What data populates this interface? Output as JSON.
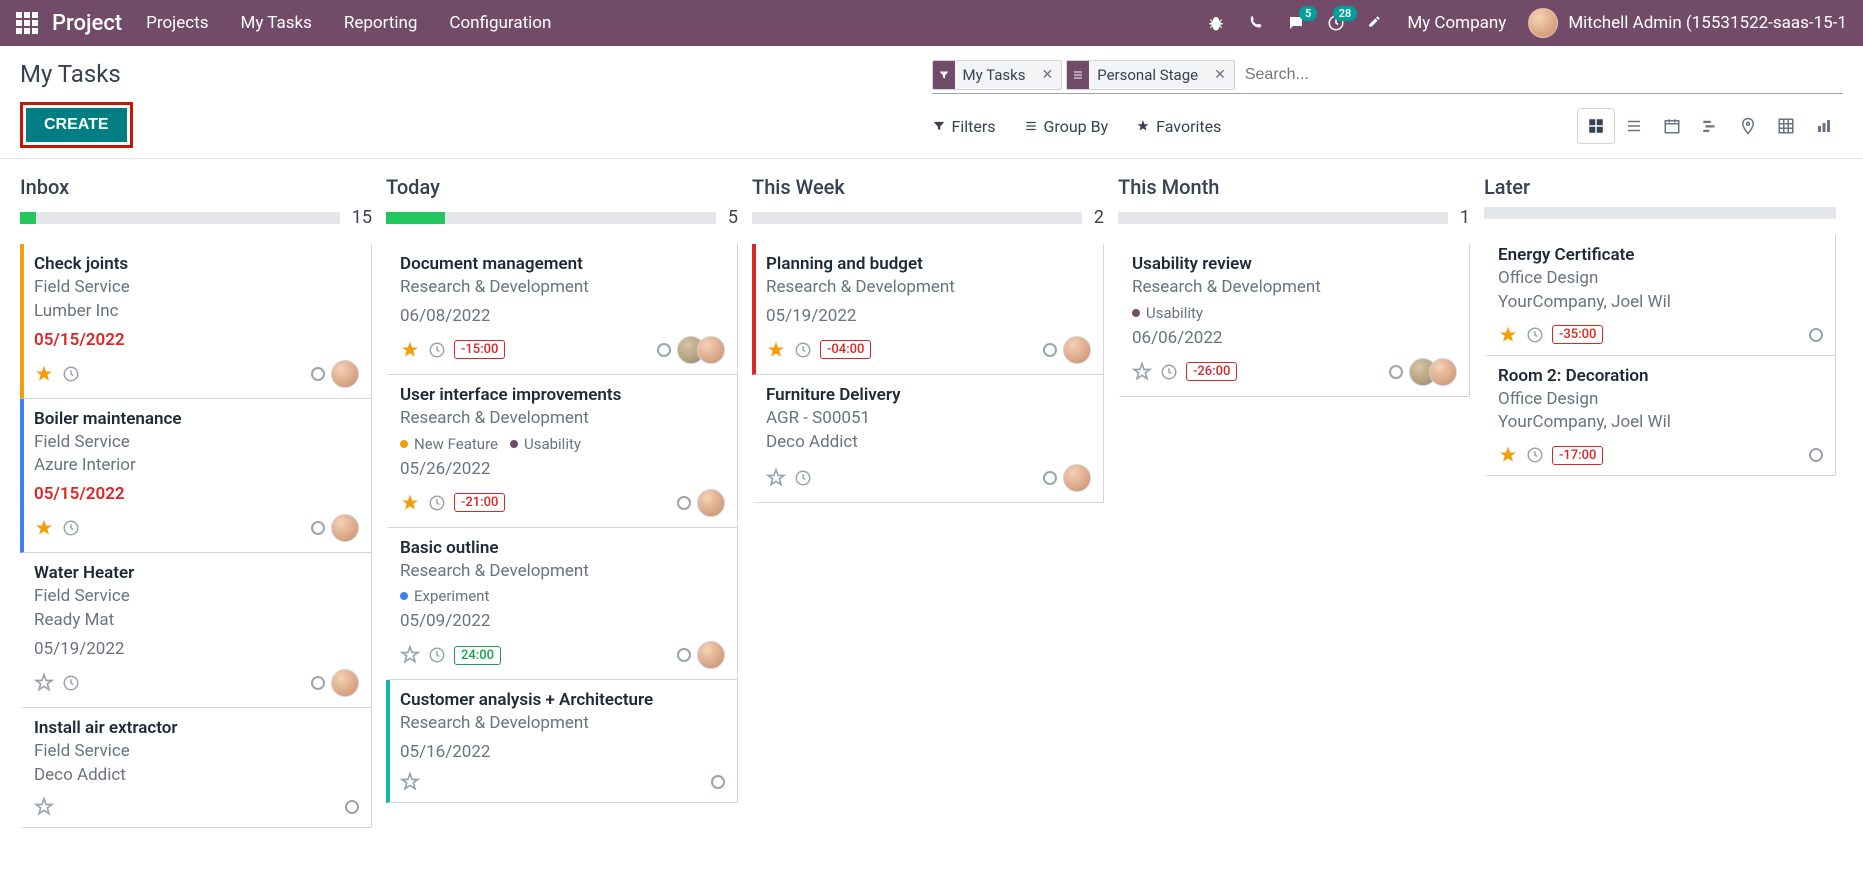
{
  "navbar": {
    "brand": "Project",
    "links": [
      "Projects",
      "My Tasks",
      "Reporting",
      "Configuration"
    ],
    "messages_badge": "5",
    "activities_badge": "28",
    "company": "My Company",
    "username": "Mitchell Admin (15531522-saas-15-1"
  },
  "control": {
    "title": "My Tasks",
    "create": "CREATE",
    "facets": [
      {
        "icon": "filter",
        "label": "My Tasks"
      },
      {
        "icon": "group",
        "label": "Personal Stage"
      }
    ],
    "search_placeholder": "Search...",
    "filters": "Filters",
    "groupby": "Group By",
    "favorites": "Favorites"
  },
  "columns": [
    {
      "title": "Inbox",
      "count": "15",
      "progress_pct": 5,
      "cards": [
        {
          "color": "orange",
          "title": "Check joints",
          "sub1": "Field Service",
          "sub2": "Lumber Inc",
          "date": "05/15/2022",
          "overdue": true,
          "star": true,
          "clock": true,
          "time": null,
          "assignees": 1
        },
        {
          "color": "blue",
          "title": "Boiler maintenance",
          "sub1": "Field Service",
          "sub2": "Azure Interior",
          "date": "05/15/2022",
          "overdue": true,
          "star": true,
          "clock": true,
          "time": null,
          "assignees": 1
        },
        {
          "color": "",
          "title": "Water Heater",
          "sub1": "Field Service",
          "sub2": "Ready Mat",
          "date": "05/19/2022",
          "overdue": false,
          "star": false,
          "clock": true,
          "time": null,
          "assignees": 1
        },
        {
          "color": "",
          "title": "Install air extractor",
          "sub1": "Field Service",
          "sub2": "Deco Addict",
          "date": "",
          "overdue": false,
          "star": false,
          "clock": false,
          "time": null,
          "assignees": 0
        }
      ]
    },
    {
      "title": "Today",
      "count": "5",
      "progress_pct": 18,
      "cards": [
        {
          "color": "",
          "title": "Document management",
          "sub1": "Research & Development",
          "sub2": "",
          "date": "06/08/2022",
          "overdue": false,
          "star": true,
          "clock": true,
          "time": "-15:00",
          "time_neg": true,
          "assignees": 2
        },
        {
          "color": "",
          "title": "User interface improvements",
          "sub1": "Research & Development",
          "sub2": "",
          "tags": [
            {
              "dot": "orange",
              "label": "New Feature"
            },
            {
              "dot": "purple",
              "label": "Usability"
            }
          ],
          "date": "05/26/2022",
          "overdue": false,
          "star": true,
          "clock": true,
          "time": "-21:00",
          "time_neg": true,
          "assignees": 1
        },
        {
          "color": "",
          "title": "Basic outline",
          "sub1": "Research & Development",
          "sub2": "",
          "tags": [
            {
              "dot": "blue",
              "label": "Experiment"
            }
          ],
          "date": "05/09/2022",
          "overdue": false,
          "star": false,
          "clock": true,
          "time": "24:00",
          "time_neg": false,
          "assignees": 1
        },
        {
          "color": "teal",
          "title": "Customer analysis + Architecture",
          "sub1": "Research & Development",
          "sub2": "",
          "date": "05/16/2022",
          "overdue": false,
          "star": false,
          "clock": false,
          "time": null,
          "assignees": 0
        }
      ]
    },
    {
      "title": "This Week",
      "count": "2",
      "progress_pct": 0,
      "cards": [
        {
          "color": "red",
          "title": "Planning and budget",
          "sub1": "Research & Development",
          "sub2": "",
          "date": "05/19/2022",
          "overdue": false,
          "star": true,
          "clock": true,
          "time": "-04:00",
          "time_neg": true,
          "assignees": 1
        },
        {
          "color": "",
          "title": "Furniture Delivery",
          "sub1": "AGR - S00051",
          "sub2": "Deco Addict",
          "date": "",
          "overdue": false,
          "star": false,
          "clock": true,
          "time": null,
          "assignees": 1
        }
      ]
    },
    {
      "title": "This Month",
      "count": "1",
      "progress_pct": 0,
      "cards": [
        {
          "color": "",
          "title": "Usability review",
          "sub1": "Research & Development",
          "sub2": "",
          "tags": [
            {
              "dot": "purple",
              "label": "Usability"
            }
          ],
          "date": "06/06/2022",
          "overdue": false,
          "star": false,
          "clock": true,
          "time": "-26:00",
          "time_neg": true,
          "assignees": 2
        }
      ]
    },
    {
      "title": "Later",
      "count": "",
      "progress_pct": 0,
      "cards": [
        {
          "color": "",
          "title": "Energy Certificate",
          "sub1": "Office Design",
          "sub2": "YourCompany, Joel Wil",
          "date": "",
          "overdue": false,
          "star": true,
          "clock": true,
          "time": "-35:00",
          "time_neg": true,
          "assignees": 0
        },
        {
          "color": "",
          "title": "Room 2: Decoration",
          "sub1": "Office Design",
          "sub2": "YourCompany, Joel Wil",
          "date": "",
          "overdue": false,
          "star": true,
          "clock": true,
          "time": "-17:00",
          "time_neg": true,
          "assignees": 0
        }
      ]
    }
  ]
}
